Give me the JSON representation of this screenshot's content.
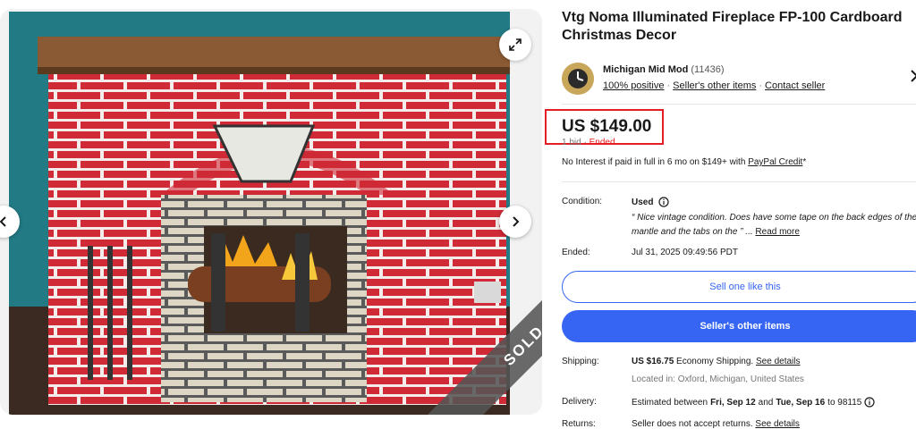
{
  "gallery": {
    "sold_badge": "SOLD",
    "icons": {
      "expand": "expand-arrows-icon",
      "prev": "chevron-left-icon",
      "next": "chevron-right-icon"
    }
  },
  "listing": {
    "title": "Vtg Noma Illuminated Fireplace FP-100 Cardboard Christmas Decor"
  },
  "seller": {
    "name": "Michigan Mid Mod",
    "feedback_count": "(11436)",
    "positive": "100% positive",
    "other_items_link": "Seller's other items",
    "contact_link": "Contact seller"
  },
  "price": {
    "amount": "US $149.00",
    "bids": "1 bid",
    "separator": "·",
    "status": "Ended"
  },
  "financing": {
    "text": "No Interest if paid in full in 6 mo on $149+ with",
    "link": "PayPal Credit",
    "suffix": "*"
  },
  "condition": {
    "label": "Condition:",
    "value": "Used",
    "quote": "“ Nice vintage condition. Does have some tape on the back edges of the mantle and the tabs on the ” ...",
    "read_more": "Read more"
  },
  "ended": {
    "label": "Ended:",
    "value": "Jul 31, 2025 09:49:56 PDT"
  },
  "buttons": {
    "sell_one": "Sell one like this",
    "other_items": "Seller's other items"
  },
  "shipping": {
    "label": "Shipping:",
    "cost": "US $16.75",
    "method": "Economy Shipping.",
    "details_link": "See details",
    "location": "Located in: Oxford, Michigan, United States"
  },
  "delivery": {
    "label": "Delivery:",
    "prefix": "Estimated between",
    "start": "Fri, Sep 12",
    "and": "and",
    "end": "Tue, Sep 16",
    "to": "to 98115"
  },
  "returns": {
    "label": "Returns:",
    "text": "Seller does not accept returns.",
    "link": "See details"
  },
  "colors": {
    "accent": "#3665f3",
    "highlight": "#e31e24",
    "sold": "#555555"
  }
}
